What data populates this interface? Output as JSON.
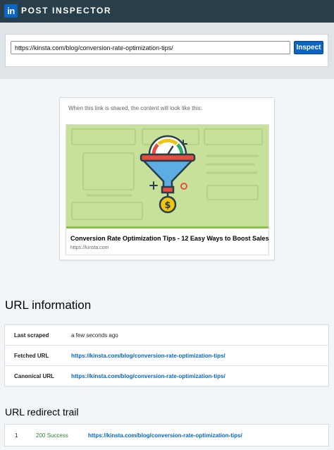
{
  "app": {
    "logo": "in",
    "title": "POST INSPECTOR"
  },
  "search": {
    "value": "https://kinsta.com/blog/conversion-rate-optimization-tips/",
    "button_label": "Inspect"
  },
  "preview": {
    "intro": "When this link is shared, the content will look like this:",
    "title": "Conversion Rate Optimization Tips - 12 Easy Ways to Boost Sales",
    "domain": "https://kinsta.com",
    "image_icon": "funnel-dollar-illustration",
    "image_bg": "#c7e19a"
  },
  "url_info": {
    "heading": "URL information",
    "rows": [
      {
        "label": "Last scraped",
        "value": "a few seconds ago"
      },
      {
        "label": "Fetched URL",
        "value": "https://kinsta.com/blog/conversion-rate-optimization-tips/"
      },
      {
        "label": "Canonical URL",
        "value": "https://kinsta.com/blog/conversion-rate-optimization-tips/"
      }
    ]
  },
  "redirect": {
    "heading": "URL redirect trail",
    "rows": [
      {
        "index": "1",
        "status": "200 Success",
        "url": "https://kinsta.com/blog/conversion-rate-optimization-tips/"
      }
    ]
  },
  "colors": {
    "brand": "#0a66c2",
    "topbar": "#283e4a",
    "success": "#2e7d32"
  }
}
